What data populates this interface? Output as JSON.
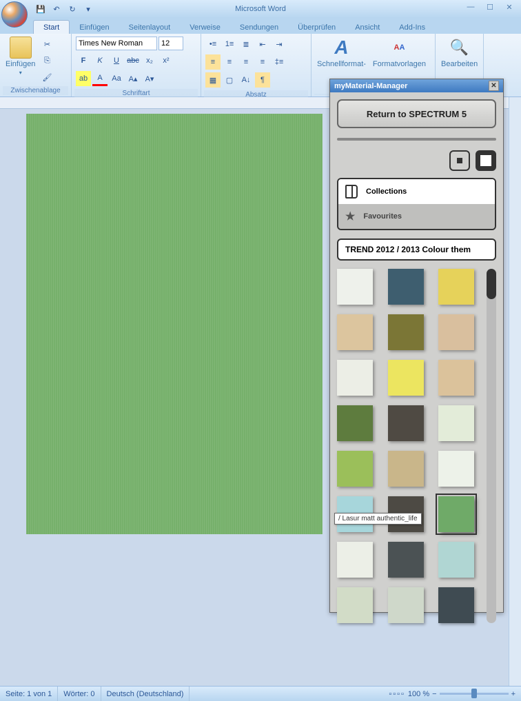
{
  "app_title": "Microsoft Word",
  "tabs": [
    "Start",
    "Einfügen",
    "Seitenlayout",
    "Verweise",
    "Sendungen",
    "Überprüfen",
    "Ansicht",
    "Add-Ins"
  ],
  "ribbon": {
    "clipboard": {
      "label": "Zwischenablage",
      "paste": "Einfügen"
    },
    "font": {
      "label": "Schriftart",
      "family": "Times New Roman",
      "size": "12"
    },
    "paragraph": {
      "label": "Absatz"
    },
    "styles": {
      "quick": "Schnellformat-",
      "styles": "Formatvorlagen"
    },
    "editing": {
      "label": "Bearbeiten"
    }
  },
  "panel": {
    "title": "myMaterial-Manager",
    "return": "Return to SPECTRUM 5",
    "collections": "Collections",
    "favourites": "Favourites",
    "filter": "TREND 2012 / 2013 Colour them",
    "tooltip": "/ Lasur matt authentic_life",
    "swatches": [
      {
        "c": "#eef1eb"
      },
      {
        "c": "#3e5e6f"
      },
      {
        "c": "#e6d25a"
      },
      {
        "c": "#dcc59e"
      },
      {
        "c": "#7b7636"
      },
      {
        "c": "#d9bf9e"
      },
      {
        "c": "#eceee6"
      },
      {
        "c": "#ece560"
      },
      {
        "c": "#dbc29b"
      },
      {
        "c": "#5e7c3e"
      },
      {
        "c": "#4f4a43"
      },
      {
        "c": "#e3ecd9"
      },
      {
        "c": "#9bbf5a"
      },
      {
        "c": "#c9b68a"
      },
      {
        "c": "#edf2e9"
      },
      {
        "c": "#a7d6db"
      },
      {
        "c": "#4d4a44"
      },
      {
        "c": "#6faa68",
        "sel": true
      },
      {
        "c": "#ecefe7"
      },
      {
        "c": "#4b5254"
      },
      {
        "c": "#b0d6d3"
      },
      {
        "c": "#d2dcc7"
      },
      {
        "c": "#cfd8ca"
      },
      {
        "c": "#3f4b52"
      }
    ]
  },
  "status": {
    "page": "Seite: 1 von 1",
    "words": "Wörter: 0",
    "lang": "Deutsch (Deutschland)",
    "zoom": "100 %"
  }
}
